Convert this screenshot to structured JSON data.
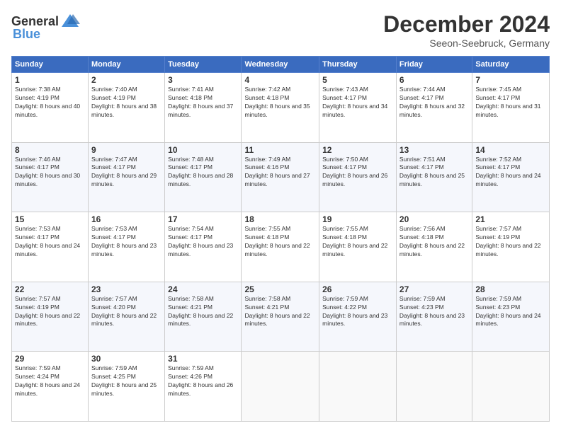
{
  "logo": {
    "general": "General",
    "blue": "Blue"
  },
  "title": "December 2024",
  "location": "Seeon-Seebruck, Germany",
  "days_header": [
    "Sunday",
    "Monday",
    "Tuesday",
    "Wednesday",
    "Thursday",
    "Friday",
    "Saturday"
  ],
  "weeks": [
    [
      {
        "day": "1",
        "sunrise": "7:38 AM",
        "sunset": "4:19 PM",
        "daylight": "8 hours and 40 minutes."
      },
      {
        "day": "2",
        "sunrise": "7:40 AM",
        "sunset": "4:19 PM",
        "daylight": "8 hours and 38 minutes."
      },
      {
        "day": "3",
        "sunrise": "7:41 AM",
        "sunset": "4:18 PM",
        "daylight": "8 hours and 37 minutes."
      },
      {
        "day": "4",
        "sunrise": "7:42 AM",
        "sunset": "4:18 PM",
        "daylight": "8 hours and 35 minutes."
      },
      {
        "day": "5",
        "sunrise": "7:43 AM",
        "sunset": "4:17 PM",
        "daylight": "8 hours and 34 minutes."
      },
      {
        "day": "6",
        "sunrise": "7:44 AM",
        "sunset": "4:17 PM",
        "daylight": "8 hours and 32 minutes."
      },
      {
        "day": "7",
        "sunrise": "7:45 AM",
        "sunset": "4:17 PM",
        "daylight": "8 hours and 31 minutes."
      }
    ],
    [
      {
        "day": "8",
        "sunrise": "7:46 AM",
        "sunset": "4:17 PM",
        "daylight": "8 hours and 30 minutes."
      },
      {
        "day": "9",
        "sunrise": "7:47 AM",
        "sunset": "4:17 PM",
        "daylight": "8 hours and 29 minutes."
      },
      {
        "day": "10",
        "sunrise": "7:48 AM",
        "sunset": "4:17 PM",
        "daylight": "8 hours and 28 minutes."
      },
      {
        "day": "11",
        "sunrise": "7:49 AM",
        "sunset": "4:16 PM",
        "daylight": "8 hours and 27 minutes."
      },
      {
        "day": "12",
        "sunrise": "7:50 AM",
        "sunset": "4:17 PM",
        "daylight": "8 hours and 26 minutes."
      },
      {
        "day": "13",
        "sunrise": "7:51 AM",
        "sunset": "4:17 PM",
        "daylight": "8 hours and 25 minutes."
      },
      {
        "day": "14",
        "sunrise": "7:52 AM",
        "sunset": "4:17 PM",
        "daylight": "8 hours and 24 minutes."
      }
    ],
    [
      {
        "day": "15",
        "sunrise": "7:53 AM",
        "sunset": "4:17 PM",
        "daylight": "8 hours and 24 minutes."
      },
      {
        "day": "16",
        "sunrise": "7:53 AM",
        "sunset": "4:17 PM",
        "daylight": "8 hours and 23 minutes."
      },
      {
        "day": "17",
        "sunrise": "7:54 AM",
        "sunset": "4:17 PM",
        "daylight": "8 hours and 23 minutes."
      },
      {
        "day": "18",
        "sunrise": "7:55 AM",
        "sunset": "4:18 PM",
        "daylight": "8 hours and 22 minutes."
      },
      {
        "day": "19",
        "sunrise": "7:55 AM",
        "sunset": "4:18 PM",
        "daylight": "8 hours and 22 minutes."
      },
      {
        "day": "20",
        "sunrise": "7:56 AM",
        "sunset": "4:18 PM",
        "daylight": "8 hours and 22 minutes."
      },
      {
        "day": "21",
        "sunrise": "7:57 AM",
        "sunset": "4:19 PM",
        "daylight": "8 hours and 22 minutes."
      }
    ],
    [
      {
        "day": "22",
        "sunrise": "7:57 AM",
        "sunset": "4:19 PM",
        "daylight": "8 hours and 22 minutes."
      },
      {
        "day": "23",
        "sunrise": "7:57 AM",
        "sunset": "4:20 PM",
        "daylight": "8 hours and 22 minutes."
      },
      {
        "day": "24",
        "sunrise": "7:58 AM",
        "sunset": "4:21 PM",
        "daylight": "8 hours and 22 minutes."
      },
      {
        "day": "25",
        "sunrise": "7:58 AM",
        "sunset": "4:21 PM",
        "daylight": "8 hours and 22 minutes."
      },
      {
        "day": "26",
        "sunrise": "7:59 AM",
        "sunset": "4:22 PM",
        "daylight": "8 hours and 23 minutes."
      },
      {
        "day": "27",
        "sunrise": "7:59 AM",
        "sunset": "4:23 PM",
        "daylight": "8 hours and 23 minutes."
      },
      {
        "day": "28",
        "sunrise": "7:59 AM",
        "sunset": "4:23 PM",
        "daylight": "8 hours and 24 minutes."
      }
    ],
    [
      {
        "day": "29",
        "sunrise": "7:59 AM",
        "sunset": "4:24 PM",
        "daylight": "8 hours and 24 minutes."
      },
      {
        "day": "30",
        "sunrise": "7:59 AM",
        "sunset": "4:25 PM",
        "daylight": "8 hours and 25 minutes."
      },
      {
        "day": "31",
        "sunrise": "7:59 AM",
        "sunset": "4:26 PM",
        "daylight": "8 hours and 26 minutes."
      },
      null,
      null,
      null,
      null
    ]
  ]
}
